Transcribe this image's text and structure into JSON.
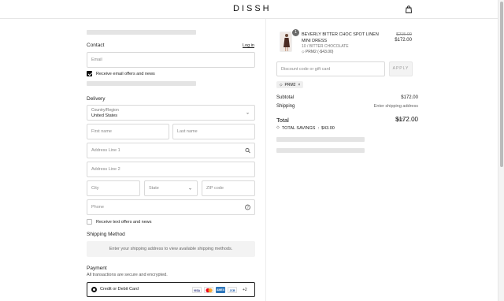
{
  "brand": {
    "logo": "DISSH"
  },
  "contact": {
    "title": "Contact",
    "login_link": "Log in",
    "email_placeholder": "Email",
    "email_offers_label": "Receive email offers and news",
    "email_offers_checked": true
  },
  "delivery": {
    "title": "Delivery",
    "country_label": "Country/Region",
    "country_value": "United States",
    "first_name_placeholder": "First name",
    "last_name_placeholder": "Last name",
    "address1_placeholder": "Address Line 1",
    "address2_placeholder": "Address Line 2",
    "city_placeholder": "City",
    "state_placeholder": "State",
    "zip_placeholder": "ZIP code",
    "phone_placeholder": "Phone",
    "text_offers_label": "Receive text offers and news",
    "text_offers_checked": false
  },
  "shipping_method": {
    "title": "Shipping Method",
    "message": "Enter your shipping address to view available shipping methods."
  },
  "payment": {
    "title": "Payment",
    "subtitle": "All transactions are secure and encrypted.",
    "option_label": "Credit or Debit Card",
    "cards": [
      {
        "name": "VISA",
        "color": "#ffffff",
        "text_color": "#1a1f71"
      },
      {
        "name": "MC",
        "color": "#ffffff",
        "text_color": "#eb001b"
      },
      {
        "name": "AMEX",
        "color": "#2e77bb",
        "text_color": "#ffffff"
      },
      {
        "name": "JCB",
        "color": "#ffffff",
        "text_color": "#0b4ea2"
      }
    ],
    "more_cards": "+2"
  },
  "order": {
    "item": {
      "quantity": "1",
      "name": "BEVERLY BITTER CHOC SPOT LINEN MINI DRESS",
      "variant": "10 / BITTER CHOCOLATE",
      "discount": "PRM2 (-$43.00)",
      "price_original": "$215.00",
      "price_final": "$172.00"
    },
    "discount_placeholder": "Discount code or gift card",
    "apply_label": "APPLY",
    "applied_code": "PRM2",
    "subtotal_label": "Subtotal",
    "subtotal_value": "$172.00",
    "shipping_label": "Shipping",
    "shipping_value": "Enter shipping address",
    "total_label": "Total",
    "currency": "USD",
    "total_value": "$172.00",
    "savings_label": "TOTAL SAVINGS",
    "savings_value": "$43.00"
  }
}
